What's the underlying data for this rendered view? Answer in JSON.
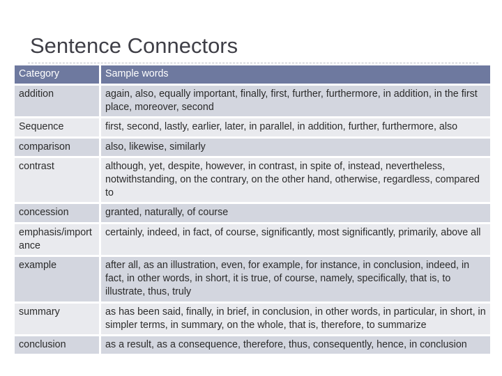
{
  "title": "Sentence Connectors",
  "table": {
    "headers": {
      "category": "Category",
      "words": "Sample words"
    },
    "rows": [
      {
        "category": "addition",
        "words": "again, also, equally important, finally, first, further, furthermore, in addition, in the first place, moreover, second"
      },
      {
        "category": "Sequence",
        "words": "first, second, lastly, earlier, later, in parallel, in addition, further, furthermore, also"
      },
      {
        "category": "comparison",
        "words": "also, likewise, similarly"
      },
      {
        "category": "contrast",
        "words": "although, yet, despite, however, in contrast, in spite of, instead, nevertheless, notwithstanding, on the contrary, on the other hand, otherwise, regardless, compared to"
      },
      {
        "category": "concession",
        "words": "granted, naturally, of course"
      },
      {
        "category": "emphasis/importance",
        "words": "certainly, indeed, in fact, of course, significantly, most significantly, primarily, above all"
      },
      {
        "category": "example",
        "words": "after all, as an illustration, even, for example, for instance, in conclusion, indeed, in fact, in other words, in short, it is true, of course, namely, specifically, that is, to illustrate, thus, truly"
      },
      {
        "category": "summary",
        "words": "as has been said, finally, in brief, in conclusion, in other words, in particular, in short, in simpler terms, in summary, on the whole, that is, therefore, to summarize"
      },
      {
        "category": "conclusion",
        "words": "as a result, as a consequence, therefore, thus, consequently, hence, in conclusion"
      }
    ]
  },
  "colors": {
    "header_bg": "#6e799f",
    "row_dark": "#d3d6df",
    "row_light": "#e9eaee"
  }
}
